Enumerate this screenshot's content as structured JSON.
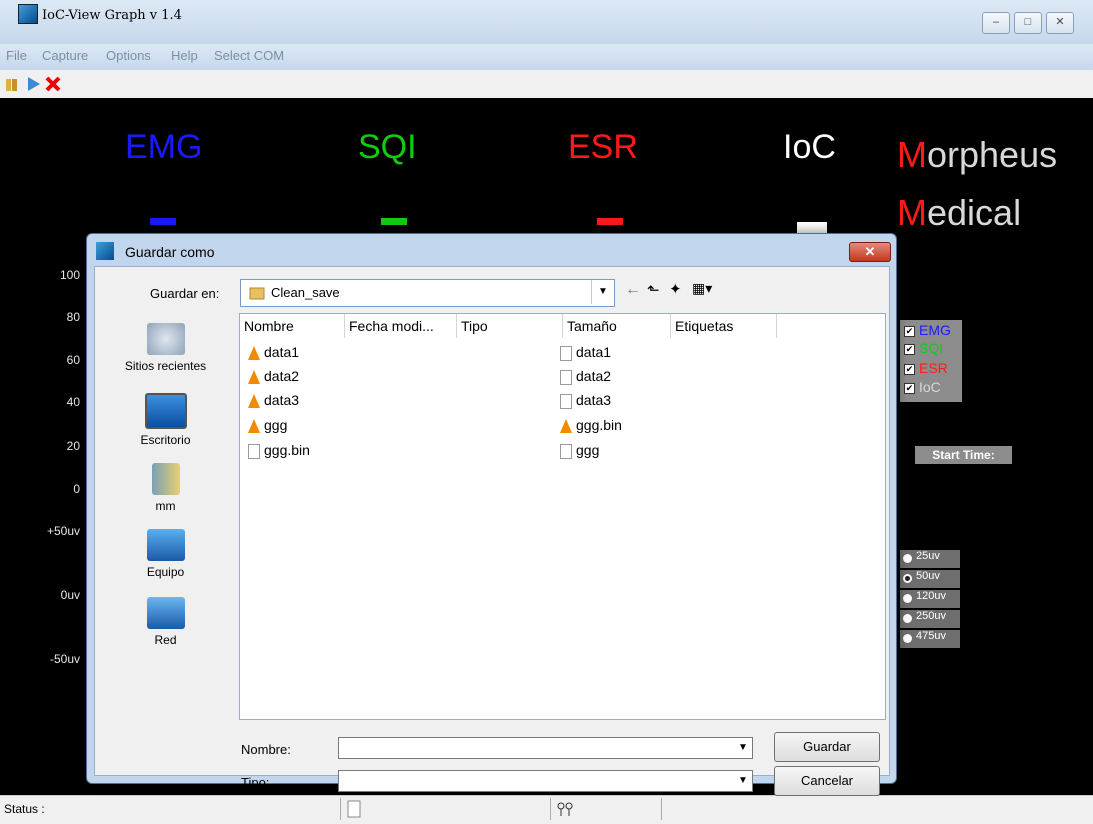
{
  "window": {
    "title": "IoC-View Graph v 1.4",
    "controls": [
      "–",
      "□",
      "✕"
    ]
  },
  "menu": [
    "File",
    "Capture",
    "Options",
    "Help",
    "Select COM"
  ],
  "toolbar": {
    "icons": [
      "open-folder-icon",
      "play-icon",
      "stop-x-icon"
    ]
  },
  "channels": [
    {
      "label": "EMG",
      "color": "#1a1aff"
    },
    {
      "label": "SQI",
      "color": "#11cc11"
    },
    {
      "label": "ESR",
      "color": "#ff1a1a"
    },
    {
      "label": "IoC",
      "color": "#ffffff"
    }
  ],
  "brand": {
    "line1_first": "M",
    "line1_rest": "orpheus",
    "line2_first": "M",
    "line2_rest": "edical"
  },
  "y_axis_ticks": [
    "100",
    "80",
    "60",
    "40",
    "20",
    "0",
    "+50uv",
    "0uv",
    "-50uv"
  ],
  "checkboxes": [
    {
      "label": "EMG",
      "checked": true,
      "color": "#1a1aff"
    },
    {
      "label": "SQI",
      "checked": true,
      "color": "#11cc11"
    },
    {
      "label": "ESR",
      "checked": true,
      "color": "#ff1a1a"
    },
    {
      "label": "IoC",
      "checked": true,
      "color": "#d8d8d8"
    }
  ],
  "start_time_label": "Start Time:",
  "scale_options": [
    {
      "label": "25uv",
      "selected": false
    },
    {
      "label": "50uv",
      "selected": true
    },
    {
      "label": "120uv",
      "selected": false
    },
    {
      "label": "250uv",
      "selected": false
    },
    {
      "label": "475uv",
      "selected": false
    }
  ],
  "statusbar": {
    "label": "Status :"
  },
  "dialog": {
    "title": "Guardar como",
    "lookin_label": "Guardar en:",
    "lookin_value": "Clean_save",
    "places": [
      "Sitios recientes",
      "Escritorio",
      "mm",
      "Equipo",
      "Red"
    ],
    "columns": [
      "Nombre",
      "Fecha modi...",
      "Tipo",
      "Tamaño",
      "Etiquetas"
    ],
    "files_col1": [
      {
        "name": "data1",
        "icon": "vlc-cone-icon"
      },
      {
        "name": "data2",
        "icon": "vlc-cone-icon"
      },
      {
        "name": "data3",
        "icon": "vlc-cone-icon"
      },
      {
        "name": "ggg",
        "icon": "vlc-cone-icon"
      },
      {
        "name": "ggg.bin",
        "icon": "document-icon"
      }
    ],
    "files_col2": [
      {
        "name": "data1",
        "icon": "document-icon"
      },
      {
        "name": "data2",
        "icon": "document-icon"
      },
      {
        "name": "data3",
        "icon": "document-icon"
      },
      {
        "name": "ggg.bin",
        "icon": "vlc-cone-icon"
      },
      {
        "name": "ggg",
        "icon": "document-icon"
      }
    ],
    "filename_label": "Nombre:",
    "filename_value": "",
    "type_label": "Tipo:",
    "type_value": "",
    "save_button": "Guardar",
    "cancel_button": "Cancelar"
  }
}
